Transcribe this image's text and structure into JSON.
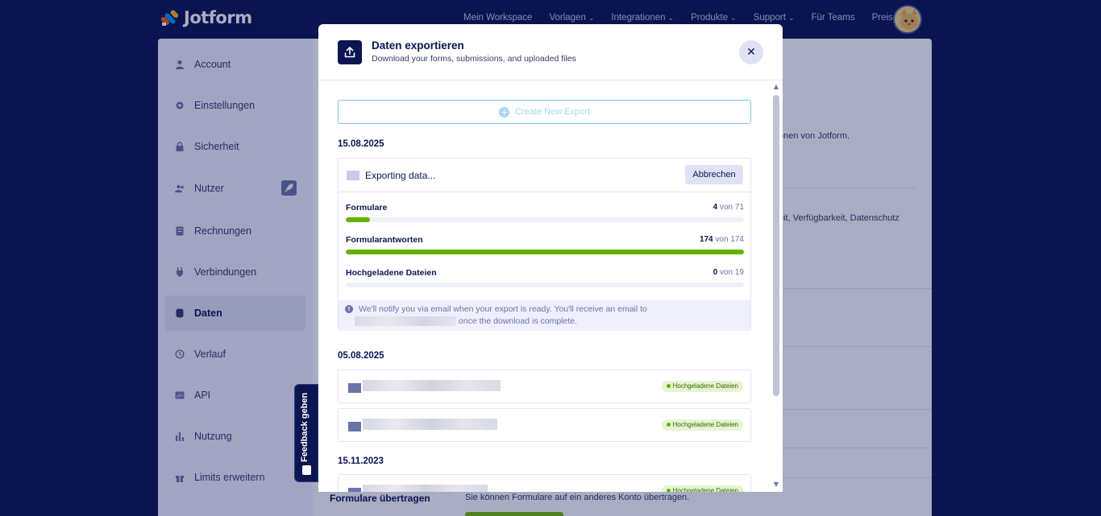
{
  "nav": {
    "brand": "Jotform",
    "links": [
      {
        "label": "Mein Workspace",
        "chevron": false
      },
      {
        "label": "Vorlagen",
        "chevron": true
      },
      {
        "label": "Integrationen",
        "chevron": true
      },
      {
        "label": "Produkte",
        "chevron": true
      },
      {
        "label": "Support",
        "chevron": true
      },
      {
        "label": "Für Teams",
        "chevron": false
      },
      {
        "label": "Preise",
        "chevron": false
      }
    ]
  },
  "sidebar": {
    "items": [
      {
        "label": "Account",
        "icon": "user-icon"
      },
      {
        "label": "Einstellungen",
        "icon": "gear-icon"
      },
      {
        "label": "Sicherheit",
        "icon": "lock-icon"
      },
      {
        "label": "Nutzer",
        "icon": "users-icon"
      },
      {
        "label": "Rechnungen",
        "icon": "invoice-icon"
      },
      {
        "label": "Verbindungen",
        "icon": "plug-icon"
      },
      {
        "label": "Daten",
        "icon": "database-icon"
      },
      {
        "label": "Verlauf",
        "icon": "history-icon"
      },
      {
        "label": "API",
        "icon": "api-icon"
      },
      {
        "label": "Nutzung",
        "icon": "chart-icon"
      },
      {
        "label": "Limits erweitern",
        "icon": "gift-icon"
      }
    ],
    "active": "Daten"
  },
  "background": {
    "line1": "onen von Jotform.",
    "line2": "eit, Verfügbarkeit, Datenschutz",
    "transfer_title": "Formulare übertragen",
    "transfer_desc": "Sie können Formulare auf ein anderes Konto übertragen."
  },
  "feedback": {
    "label": "Feedback geben"
  },
  "modal": {
    "title": "Daten exportieren",
    "subtitle": "Download your forms, submissions, and uploaded files",
    "create_label": "Create New Export",
    "current": {
      "date": "15.08.2025",
      "status": "Exporting data...",
      "cancel_label": "Abbrechen",
      "progress": [
        {
          "name": "Formulare",
          "done": "4",
          "of": "von 71",
          "fraction": 0.0563
        },
        {
          "name": "Formularantworten",
          "done": "174",
          "of": "von 174",
          "fraction": 1.0
        },
        {
          "name": "Hochgeladene Dateien",
          "done": "0",
          "of": "von 19",
          "fraction": 0.0
        }
      ],
      "notice_line1": "We'll notify you via email when your export is ready. You'll receive an email to",
      "notice_line2": "once the download is complete."
    },
    "history": [
      {
        "date": "05.08.2025",
        "files": [
          {
            "tag": "Hochgeladene Dateien"
          },
          {
            "tag": "Hochgeladene Dateien"
          }
        ]
      },
      {
        "date": "15.11.2023",
        "files": [
          {
            "tag": "Hochgeladene Dateien"
          }
        ]
      }
    ]
  },
  "colors": {
    "navy": "#0a1551",
    "green": "#64b200",
    "accent_blue": "#7ec8e8"
  }
}
